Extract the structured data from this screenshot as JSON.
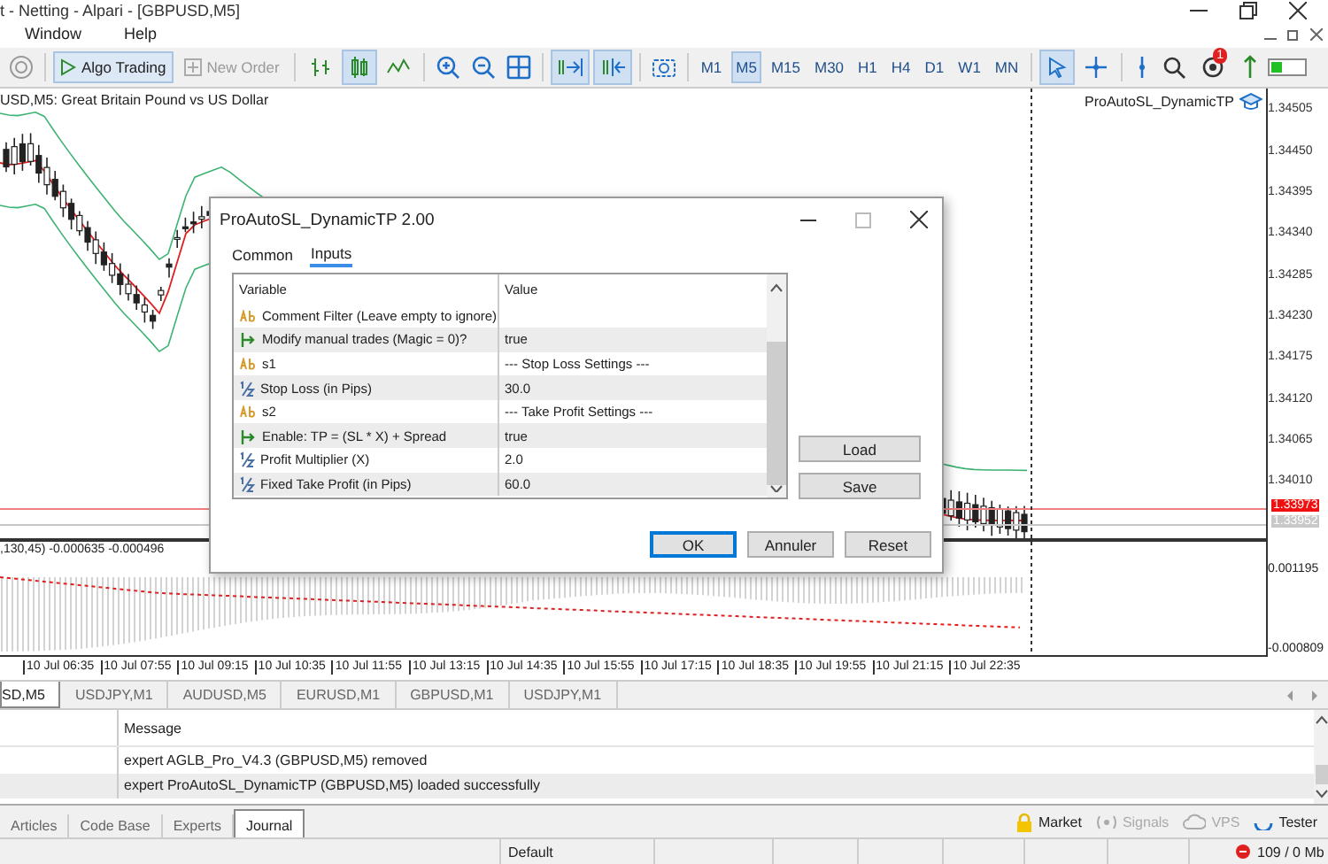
{
  "window": {
    "title": "t - Netting - Alpari - [GBPUSD,M5]"
  },
  "menu": [
    "Window",
    "Help"
  ],
  "toolbar": {
    "algo_trading": {
      "label": "Algo Trading",
      "on": true
    },
    "new_order": {
      "label": "New Order",
      "disabled": true
    },
    "chart_types": [
      {
        "kind": "bars",
        "selected": false
      },
      {
        "kind": "candles",
        "selected": true
      },
      {
        "kind": "line",
        "selected": false
      }
    ],
    "chart_tools": [
      {
        "kind": "autoscroll",
        "on": true
      },
      {
        "kind": "shift",
        "on": true
      }
    ],
    "timeframes": [
      {
        "label": "M1",
        "selected": false
      },
      {
        "label": "M5",
        "selected": true
      },
      {
        "label": "M15",
        "selected": false
      },
      {
        "label": "M30",
        "selected": false
      },
      {
        "label": "H1",
        "selected": false
      },
      {
        "label": "H4",
        "selected": false
      },
      {
        "label": "D1",
        "selected": false
      },
      {
        "label": "W1",
        "selected": false
      },
      {
        "label": "MN",
        "selected": false
      }
    ],
    "pointer_tools": [
      {
        "kind": "cursor",
        "selected": true
      },
      {
        "kind": "crosshair",
        "selected": false
      }
    ],
    "notifications": "1"
  },
  "chart": {
    "title": "USD,M5:  Great Britain Pound vs US Dollar",
    "expert": "ProAutoSL_DynamicTP",
    "price_labels": [
      "1.34505",
      "1.34450",
      "1.34395",
      "1.34340",
      "1.34285",
      "1.34230",
      "1.34175",
      "1.34120",
      "1.34065",
      "1.34010"
    ],
    "bid_tag": "1.33973",
    "ask_tag": "1.33952",
    "indicator": {
      "label": ",130,45) -0.000635 -0.000496",
      "scale": [
        "0.001195",
        "-0.000809"
      ]
    },
    "time_labels": [
      "10 Jul 06:35",
      "10 Jul 07:55",
      "10 Jul 09:15",
      "10 Jul 10:35",
      "10 Jul 11:55",
      "10 Jul 13:15",
      "10 Jul 14:35",
      "10 Jul 15:55",
      "10 Jul 17:15",
      "10 Jul 18:35",
      "10 Jul 19:55",
      "10 Jul 21:15",
      "10 Jul 22:35"
    ]
  },
  "chart_tabs": [
    {
      "label": "SD,M5",
      "selected": true
    },
    {
      "label": "USDJPY,M1",
      "selected": false
    },
    {
      "label": "AUDUSD,M5",
      "selected": false
    },
    {
      "label": "EURUSD,M1",
      "selected": false
    },
    {
      "label": "GBPUSD,M1",
      "selected": false
    },
    {
      "label": "USDJPY,M1",
      "selected": false
    }
  ],
  "journal": {
    "column": "Message",
    "rows": [
      {
        "message": "expert AGLB_Pro_V4.3 (GBPUSD,M5) removed",
        "selected": false
      },
      {
        "message": "expert ProAutoSL_DynamicTP (GBPUSD,M5) loaded successfully",
        "selected": true
      }
    ]
  },
  "bottom_tabs": [
    {
      "label": "Articles",
      "selected": false
    },
    {
      "label": "Code Base",
      "selected": false
    },
    {
      "label": "Experts",
      "selected": false
    },
    {
      "label": "Journal",
      "selected": true
    }
  ],
  "services": [
    {
      "kind": "market",
      "label": "Market",
      "disabled": false
    },
    {
      "kind": "signals",
      "label": "Signals",
      "disabled": true
    },
    {
      "kind": "vps",
      "label": "VPS",
      "disabled": true
    },
    {
      "kind": "tester",
      "label": "Tester",
      "disabled": false
    }
  ],
  "status_bar": {
    "profile": "Default",
    "memory": "109 / 0 Mb"
  },
  "dialog": {
    "title": "ProAutoSL_DynamicTP 2.00",
    "tabs": [
      {
        "label": "Common",
        "selected": false
      },
      {
        "label": "Inputs",
        "selected": true
      }
    ],
    "columns": [
      "Variable",
      "Value"
    ],
    "rows": [
      {
        "kind": "text",
        "variable": "Comment Filter (Leave empty to ignore)"
      },
      {
        "kind": "bool",
        "variable": "Modify manual trades (Magic = 0)?",
        "value": "true"
      },
      {
        "kind": "text",
        "variable": "s1",
        "value": "--- Stop Loss Settings ---"
      },
      {
        "kind": "number",
        "variable": "Stop Loss (in Pips)",
        "value": "30.0"
      },
      {
        "kind": "text",
        "variable": "s2",
        "value": "--- Take Profit Settings ---"
      },
      {
        "kind": "bool",
        "variable": "Enable: TP = (SL * X) + Spread",
        "value": "true"
      },
      {
        "kind": "number",
        "variable": "Profit Multiplier (X)",
        "value": "2.0"
      },
      {
        "kind": "number",
        "variable": "Fixed Take Profit (in Pips)",
        "value": "60.0"
      }
    ],
    "side_buttons": [
      "Load",
      "Save"
    ],
    "buttons": [
      {
        "label": "OK",
        "default": true
      },
      {
        "label": "Annuler",
        "default": false
      },
      {
        "label": "Reset",
        "default": false
      }
    ]
  }
}
